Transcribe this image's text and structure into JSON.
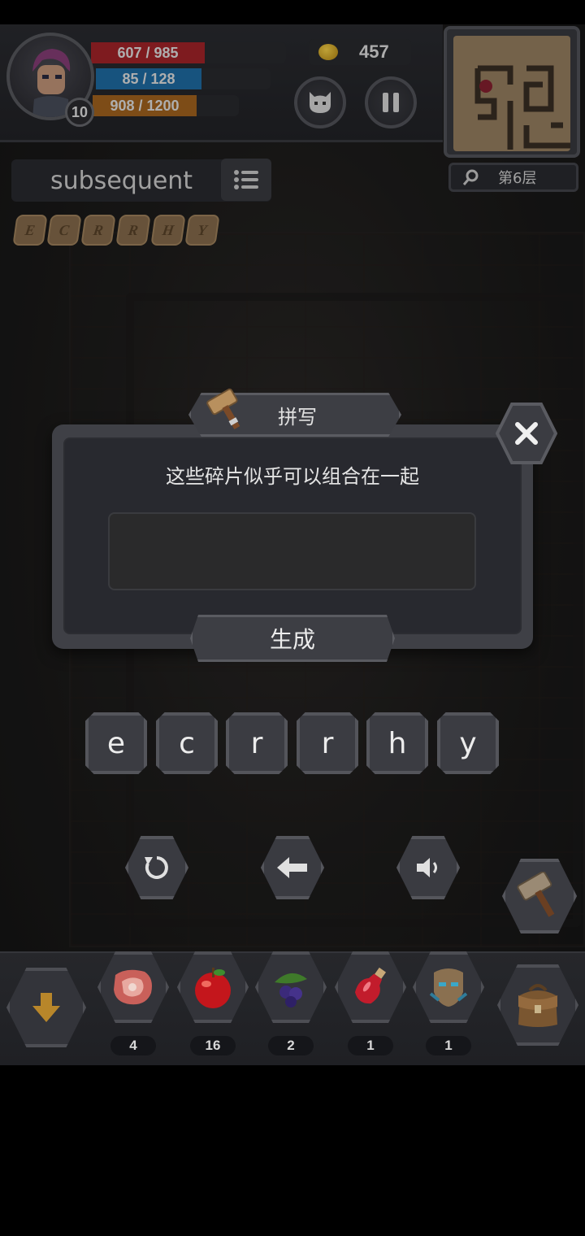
{
  "hud": {
    "level": "10",
    "hp": "607 / 985",
    "mp": "85 / 128",
    "xp": "908 / 1200",
    "coins": "457",
    "floor": "第6层"
  },
  "word_panel": {
    "word": "subsequent",
    "fragments": [
      "E",
      "C",
      "R",
      "R",
      "H",
      "Y"
    ]
  },
  "dialog": {
    "title": "拼写",
    "prompt": "这些碎片似乎可以组合在一起",
    "input_value": "",
    "generate_label": "生成"
  },
  "letters": [
    "e",
    "c",
    "r",
    "r",
    "h",
    "y"
  ],
  "inventory": {
    "items": [
      {
        "name": "meat-icon",
        "count": "4"
      },
      {
        "name": "apple-icon",
        "count": "16"
      },
      {
        "name": "berries-icon",
        "count": "2"
      },
      {
        "name": "potion-icon",
        "count": "1"
      },
      {
        "name": "mask-icon",
        "count": "1"
      }
    ]
  },
  "colors": {
    "hp": "#a8242a",
    "mp": "#1f6fa8",
    "xp": "#a7661f",
    "panel": "#28292f"
  }
}
